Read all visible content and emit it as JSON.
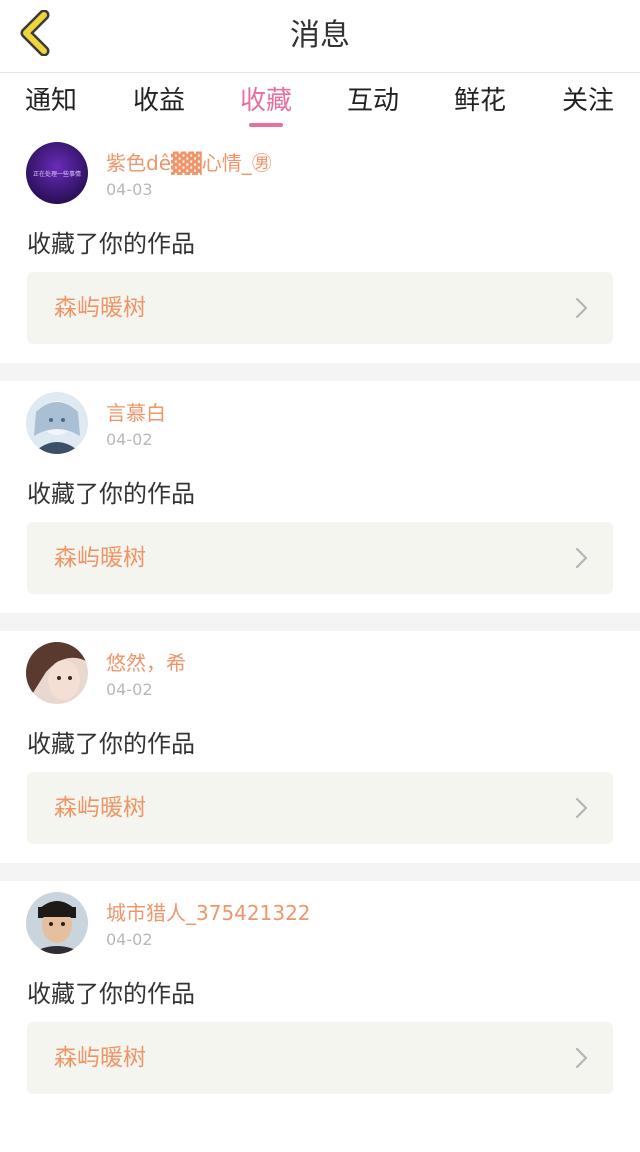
{
  "header": {
    "title": "消息",
    "back_icon": "chevron-left-icon",
    "back_color": "#f0d53a"
  },
  "tabs": [
    {
      "label": "通知",
      "active": false
    },
    {
      "label": "收益",
      "active": false
    },
    {
      "label": "收藏",
      "active": true
    },
    {
      "label": "互动",
      "active": false
    },
    {
      "label": "鲜花",
      "active": false
    },
    {
      "label": "关注",
      "active": false
    }
  ],
  "colors": {
    "accent": "#e96fa2",
    "username": "#f0956a",
    "work_title": "#ee9668",
    "card_bg": "#f5f5ef"
  },
  "feed": [
    {
      "username": "紫色dê▓▓心情_㊚",
      "date": "04-03",
      "action": "收藏了你的作品",
      "work_title": "森屿暖树",
      "avatar_text": "正在处理一些事情"
    },
    {
      "username": "言慕白",
      "date": "04-02",
      "action": "收藏了你的作品",
      "work_title": "森屿暖树"
    },
    {
      "username": "悠然，希",
      "date": "04-02",
      "action": "收藏了你的作品",
      "work_title": "森屿暖树"
    },
    {
      "username": "城市猎人_375421322",
      "date": "04-02",
      "action": "收藏了你的作品",
      "work_title": "森屿暖树"
    }
  ]
}
